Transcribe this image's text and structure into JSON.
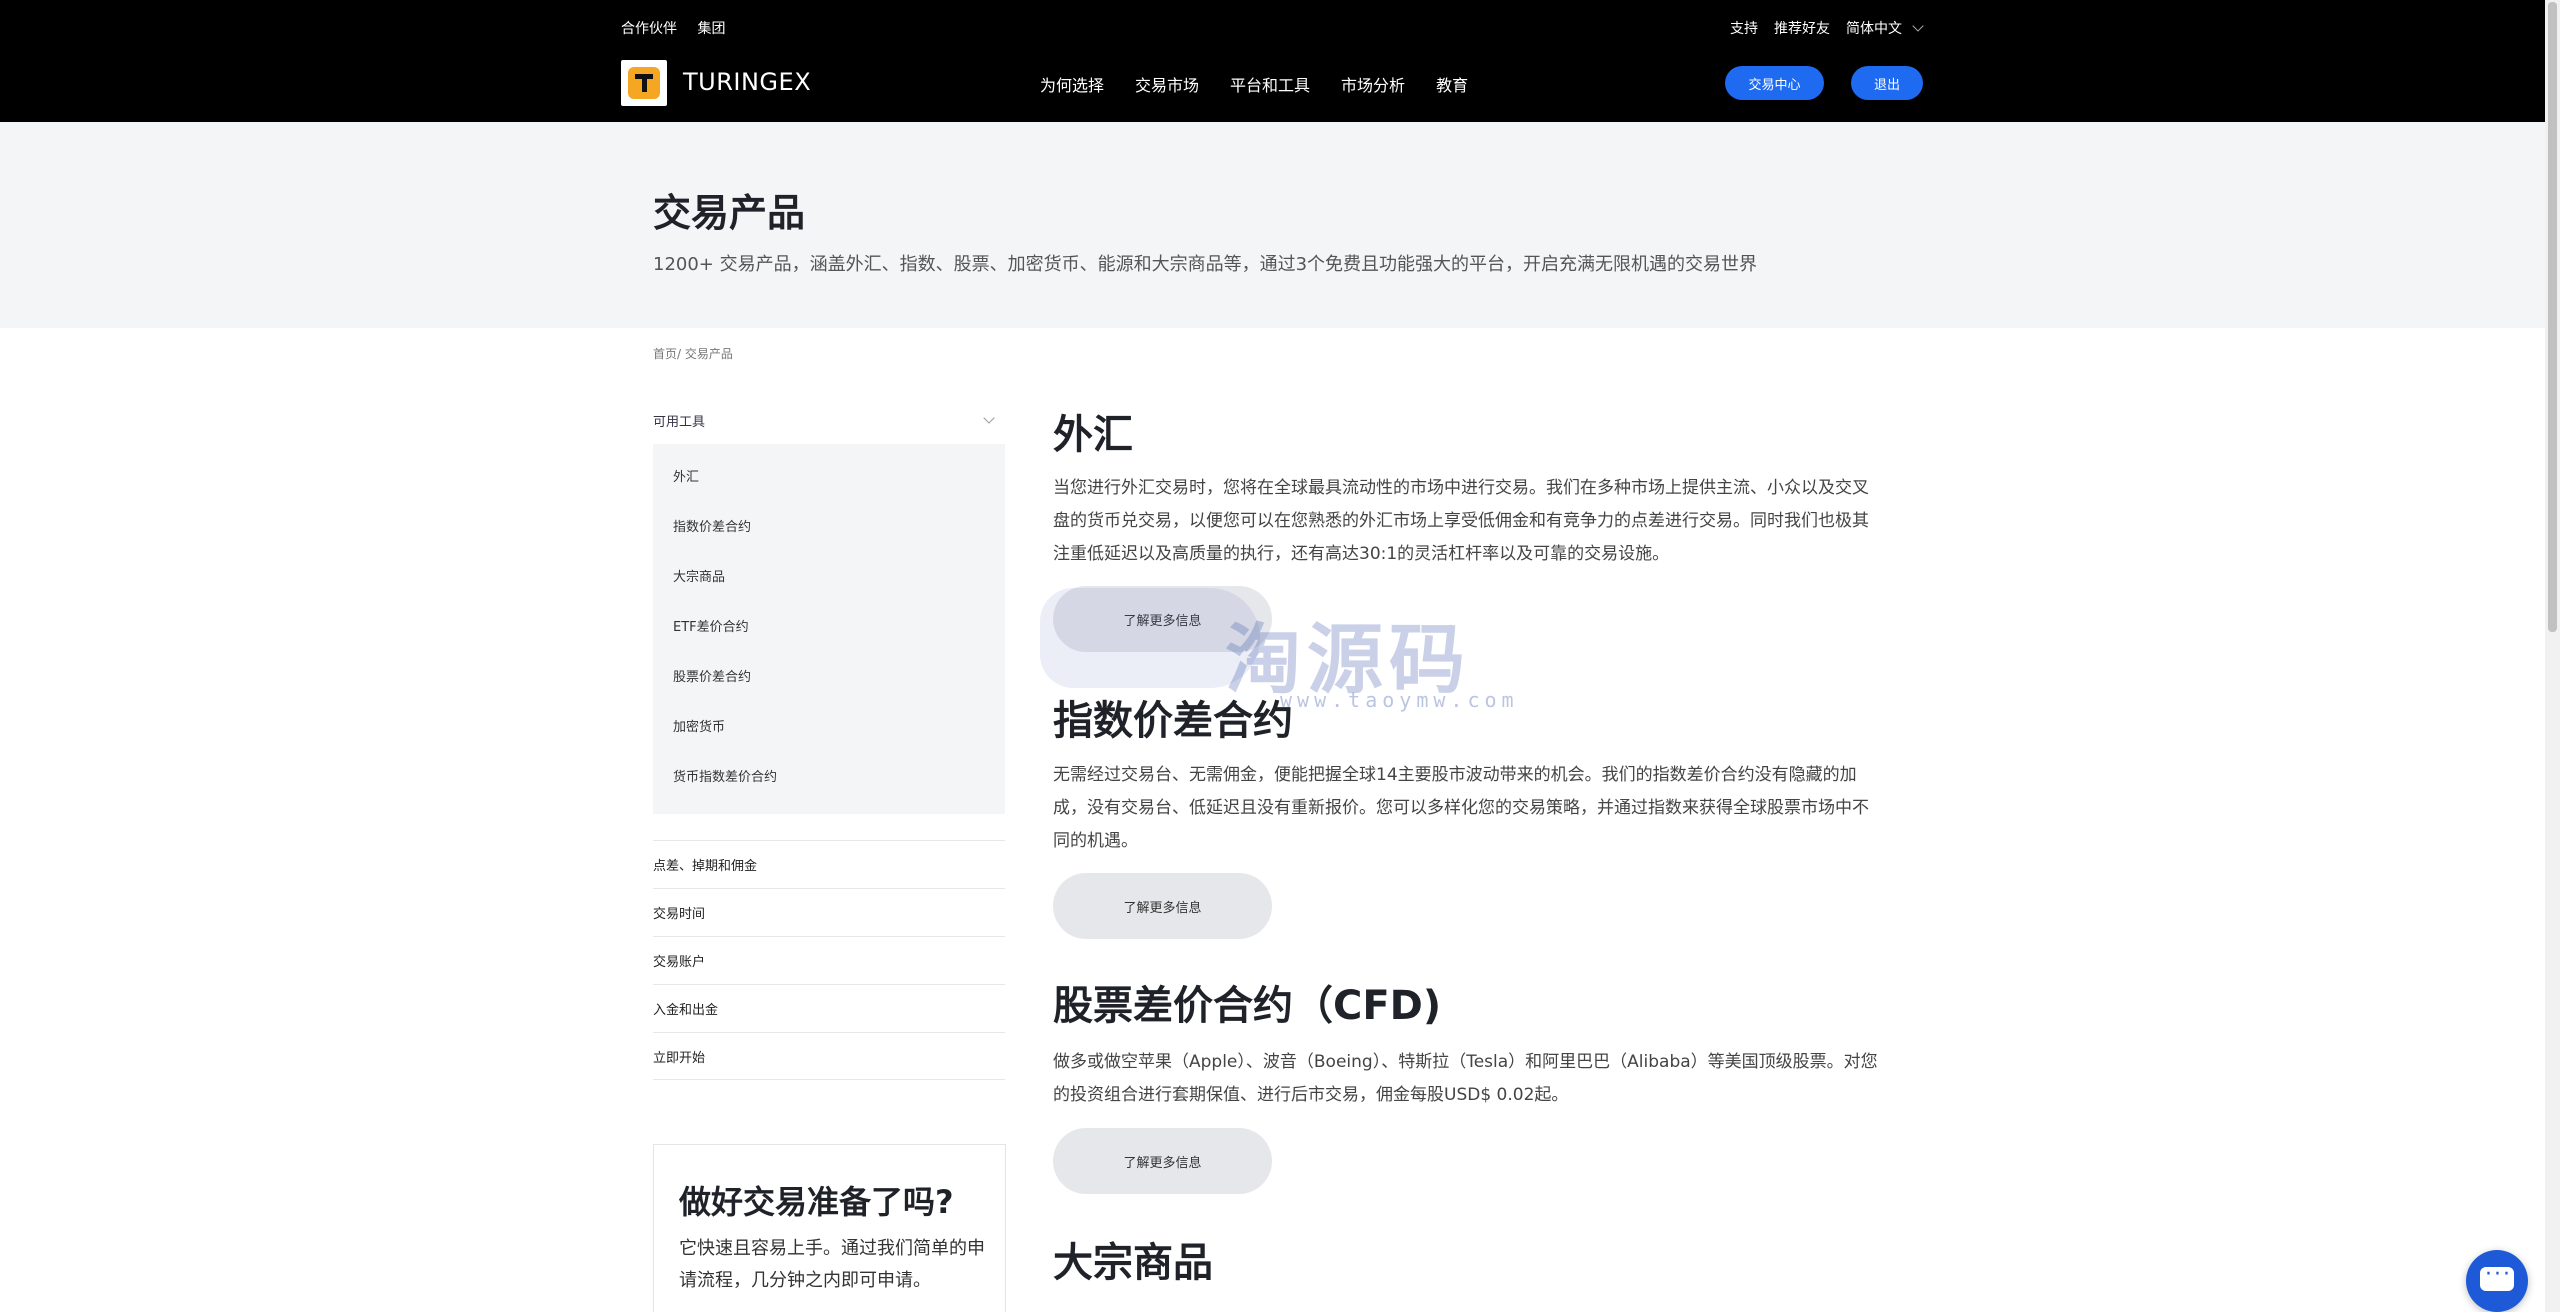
{
  "header": {
    "top_left": [
      "合作伙伴",
      "集团"
    ],
    "top_right": [
      "支持",
      "推荐好友",
      "简体中文"
    ],
    "brand": "TURINGEX",
    "nav": [
      "为何选择",
      "交易市场",
      "平台和工具",
      "市场分析",
      "教育"
    ],
    "btn_center": "交易中心",
    "btn_logout": "退出"
  },
  "hero": {
    "title": "交易产品",
    "subtitle": "1200+ 交易产品，涵盖外汇、指数、股票、加密货币、能源和大宗商品等，通过3个免费且功能强大的平台，开启充满无限机遇的交易世界"
  },
  "breadcrumb": "首页/ 交易产品",
  "sidebar": {
    "head": "可用工具",
    "sub_items": [
      "外汇",
      "指数价差合约",
      "大宗商品",
      "ETF差价合约",
      "股票价差合约",
      "加密货币",
      "货币指数差价合约"
    ],
    "links": [
      "点差、掉期和佣金",
      "交易时间",
      "交易账户",
      "入金和出金",
      "立即开始"
    ],
    "cta_title": "做好交易准备了吗?",
    "cta_text": "它快速且容易上手。通过我们简单的申请流程，几分钟之内即可申请。"
  },
  "sections": [
    {
      "title": "外汇",
      "desc": "当您进行外汇交易时，您将在全球最具流动性的市场中进行交易。我们在多种市场上提供主流、小众以及交叉盘的货币兑交易，以便您可以在您熟悉的外汇市场上享受低佣金和有竞争力的点差进行交易。同时我们也极其注重低延迟以及高质量的执行，还有高达30:1的灵活杠杆率以及可靠的交易设施。",
      "btn": "了解更多信息"
    },
    {
      "title": "指数价差合约",
      "desc": "无需经过交易台、无需佣金，便能把握全球14主要股市波动带来的机会。我们的指数差价合约没有隐藏的加成，没有交易台、低延迟且没有重新报价。您可以多样化您的交易策略，并通过指数来获得全球股票市场中不同的机遇。",
      "btn": "了解更多信息"
    },
    {
      "title": "股票差价合约（CFD)",
      "desc": "做多或做空苹果（Apple）、波音（Boeing）、特斯拉（Tesla）和阿里巴巴（Alibaba）等美国顶级股票。对您的投资组合进行套期保值、进行后市交易，佣金每股USD$ 0.02起。",
      "btn": "了解更多信息"
    },
    {
      "title": "大宗商品"
    }
  ],
  "watermark": {
    "text": "淘源码",
    "sub": "www.taoymw.com"
  },
  "colors": {
    "accent": "#1e6bf2",
    "header_bg": "#000000",
    "hero_bg": "#f4f5f7",
    "logo": "#f5a623"
  }
}
